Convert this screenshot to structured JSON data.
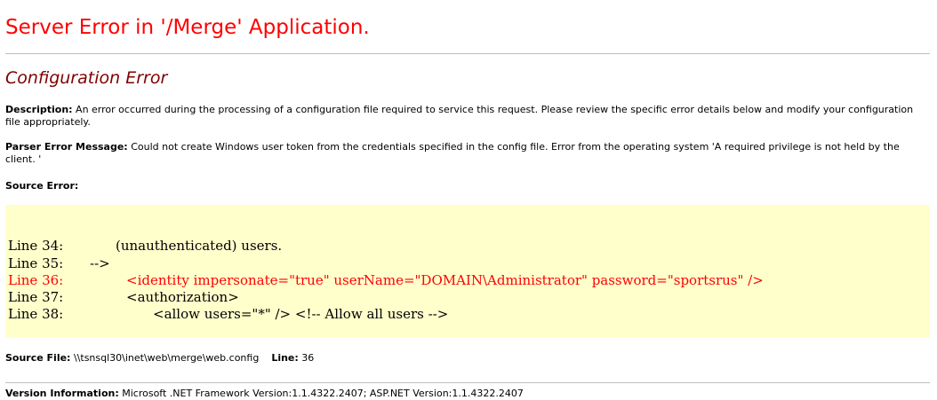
{
  "title": "Server Error in '/Merge' Application.",
  "subtitle": "Configuration Error",
  "description": {
    "label": "Description:",
    "text": "An error occurred during the processing of a configuration file required to service this request. Please review the specific error details below and modify your configuration file appropriately."
  },
  "parser_error": {
    "label": "Parser Error Message:",
    "text": "Could not create Windows user token from the credentials specified in the config file. Error from the operating system 'A required privilege is not held by the client. '"
  },
  "source_error": {
    "label": "Source Error:",
    "lines": [
      {
        "number": "Line 34:",
        "code": "(unauthenticated) users."
      },
      {
        "number": "Line 35:",
        "code": "-->"
      },
      {
        "number": "Line 36:",
        "code": "<identity impersonate=\"true\" userName=\"DOMAIN\\Administrator\" password=\"sportsrus\" />"
      },
      {
        "number": "Line 37:",
        "code": "<authorization>"
      },
      {
        "number": "Line 38:",
        "code": "<allow users=\"*\" /> <!-- Allow all users -->"
      }
    ],
    "error_color": "#ff0000",
    "background_color": "#ffffcc"
  },
  "source_file": {
    "label": "Source File:",
    "path": "\\\\tsnsql30\\inet\\web\\merge\\web.config",
    "line_label": "Line:",
    "line_value": "36"
  },
  "version": {
    "label": "Version Information:",
    "text": "Microsoft .NET Framework Version:1.1.4322.2407; ASP.NET Version:1.1.4322.2407"
  },
  "colors": {
    "title": "#ff0000",
    "subtitle": "#800000",
    "divider": "#c0c0c0"
  }
}
